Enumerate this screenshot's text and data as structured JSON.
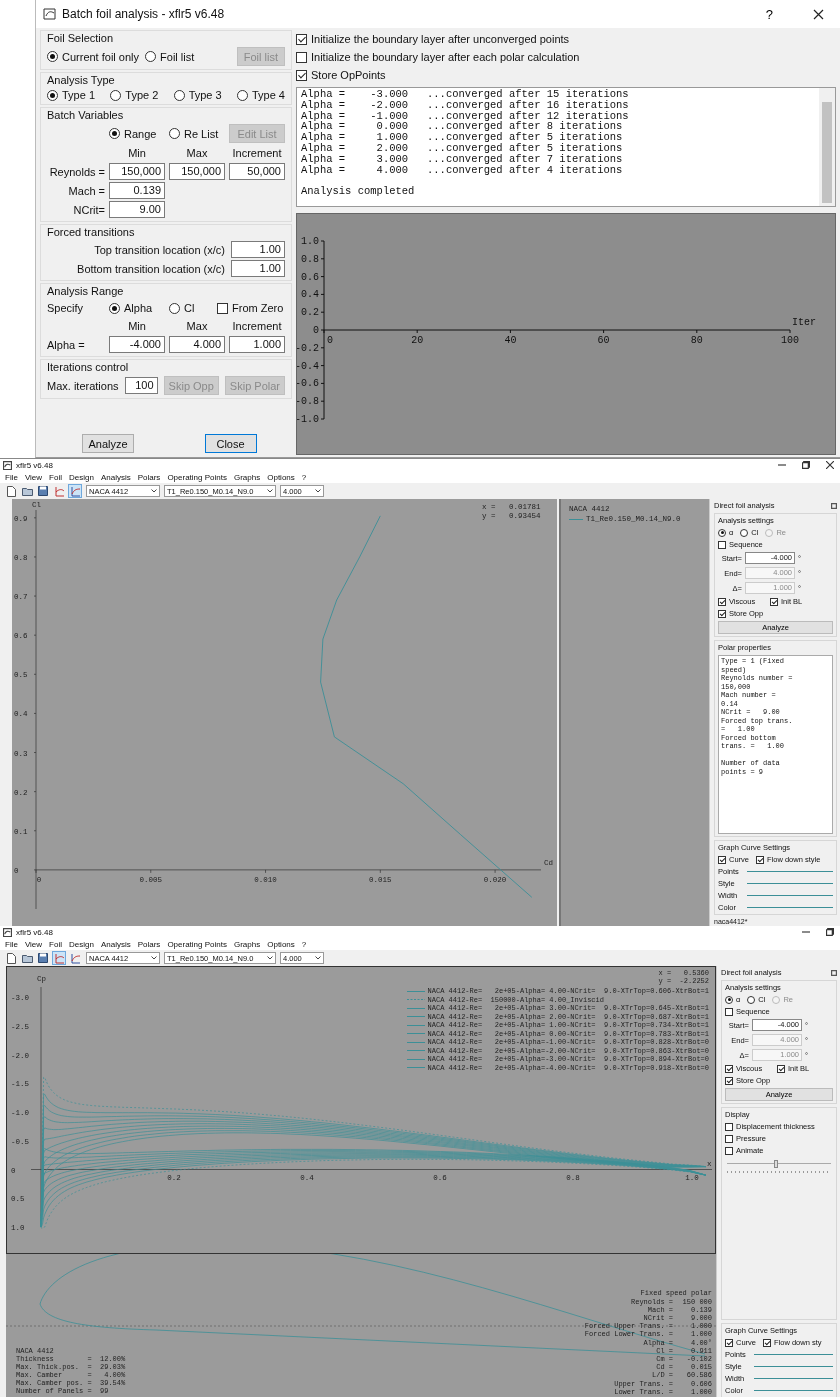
{
  "dialog": {
    "title": "Batch foil analysis - xflr5 v6.48",
    "help": "?",
    "foil_selection": {
      "title": "Foil Selection",
      "options": [
        {
          "label": "Current foil only",
          "selected": true
        },
        {
          "label": "Foil list",
          "selected": false
        }
      ],
      "button": {
        "label": "Foil list",
        "disabled": true
      }
    },
    "analysis_type": {
      "title": "Analysis Type",
      "options": [
        {
          "label": "Type 1",
          "selected": true
        },
        {
          "label": "Type 2",
          "selected": false
        },
        {
          "label": "Type 3",
          "selected": false
        },
        {
          "label": "Type 4",
          "selected": false
        }
      ]
    },
    "batch_variables": {
      "title": "Batch Variables",
      "options": [
        {
          "label": "Range",
          "selected": true
        },
        {
          "label": "Re List",
          "selected": false
        }
      ],
      "button": {
        "label": "Edit List",
        "disabled": true
      },
      "columns": [
        "Min",
        "Max",
        "Increment"
      ],
      "rows": [
        {
          "label": "Reynolds =",
          "values": [
            "150,000",
            "150,000",
            "50,000"
          ]
        },
        {
          "label": "Mach =",
          "values": [
            "0.139"
          ]
        },
        {
          "label": "NCrit=",
          "values": [
            "9.00"
          ]
        }
      ]
    },
    "forced_transitions": {
      "title": "Forced transitions",
      "rows": [
        {
          "label": "Top transition location (x/c)",
          "value": "1.00"
        },
        {
          "label": "Bottom transition location (x/c)",
          "value": "1.00"
        }
      ]
    },
    "analysis_range": {
      "title": "Analysis Range",
      "specify": "Specify",
      "options": [
        {
          "label": "Alpha",
          "selected": true
        },
        {
          "label": "Cl",
          "selected": false
        }
      ],
      "from_zero": {
        "label": "From Zero",
        "checked": false
      },
      "columns": [
        "Min",
        "Max",
        "Increment"
      ],
      "rows": [
        {
          "label": "Alpha =",
          "values": [
            "-4.000",
            "4.000",
            "1.000"
          ]
        }
      ]
    },
    "iterations": {
      "title": "Iterations control",
      "label": "Max. iterations",
      "value": "100",
      "buttons": [
        {
          "label": "Skip Opp",
          "disabled": true
        },
        {
          "label": "Skip Polar",
          "disabled": true
        }
      ]
    },
    "buttons": [
      {
        "label": "Analyze",
        "default": false
      },
      {
        "label": "Close",
        "default": true
      }
    ],
    "options": [
      {
        "label": "Initialize the boundary layer after unconverged points",
        "checked": true
      },
      {
        "label": "Initialize the boundary layer after each polar calculation",
        "checked": false
      },
      {
        "label": "Store OpPoints",
        "checked": true
      }
    ],
    "log": [
      "Alpha =    -3.000   ...converged after 15 iterations",
      "Alpha =    -2.000   ...converged after 16 iterations",
      "Alpha =    -1.000   ...converged after 12 iterations",
      "Alpha =     0.000   ...converged after 8 iterations",
      "Alpha =     1.000   ...converged after 5 iterations",
      "Alpha =     2.000   ...converged after 5 iterations",
      "Alpha =     3.000   ...converged after 7 iterations",
      "Alpha =     4.000   ...converged after 4 iterations"
    ],
    "log_summary": "Analysis completed",
    "chart_data": {
      "type": "line",
      "xlabel": "Iter",
      "xlim": [
        0,
        100
      ],
      "ylim": [
        -1,
        1
      ],
      "xticks": [
        0,
        20,
        40,
        60,
        80,
        100
      ],
      "yticks": [
        {
          "value": 1,
          "label": "1.0"
        },
        {
          "value": 0.8,
          "label": "0.8"
        },
        {
          "value": 0.6,
          "label": "0.6"
        },
        {
          "value": 0.4,
          "label": "0.4"
        },
        {
          "value": 0.2,
          "label": "0.2"
        },
        {
          "value": 0,
          "label": "0"
        },
        {
          "value": -0.2,
          "label": "-0.2"
        },
        {
          "value": -0.4,
          "label": "-0.4"
        },
        {
          "value": -0.6,
          "label": "-0.6"
        },
        {
          "value": -0.8,
          "label": "-0.8"
        },
        {
          "value": -1,
          "label": "-1.0"
        }
      ]
    }
  },
  "windows": [
    {
      "kind": "polar_view",
      "title": "xflr5 v6.48",
      "menu": [
        "File",
        "View",
        "Foil",
        "Design",
        "Analysis",
        "Polars",
        "Operating Points",
        "Graphs",
        "Options",
        "?"
      ],
      "tools": [
        {
          "selected": false
        },
        {
          "selected": false
        },
        {
          "selected": false
        },
        {
          "selected": false
        },
        {
          "selected": true
        }
      ],
      "combos": [
        "NACA 4412",
        "T1_Re0.150_M0.14_N9.0",
        "4.000"
      ],
      "readout": [
        "x =   0.01781",
        "y =   0.93454"
      ],
      "chart_data": {
        "type": "line",
        "xlabel": "Cd",
        "ylabel": "Cl",
        "xlim": [
          0,
          0.022
        ],
        "ylim": [
          -0.1,
          0.92
        ],
        "x": [
          0.0216,
          0.0185,
          0.016,
          0.013,
          0.0124,
          0.0125,
          0.0131,
          0.0141,
          0.015
        ],
        "series": [
          {
            "name": "T1_Re0.150_M0.14_N9.0",
            "color": "#3c8f97",
            "values": [
              -0.07,
              0.09,
              0.22,
              0.34,
              0.48,
              0.59,
              0.69,
              0.8,
              0.905
            ]
          }
        ],
        "xticks": [
          {
            "value": 0,
            "label": "0"
          },
          {
            "value": 0.005,
            "label": "0.005"
          },
          {
            "value": 0.01,
            "label": "0.010"
          },
          {
            "value": 0.015,
            "label": "0.015"
          },
          {
            "value": 0.02,
            "label": "0.020"
          }
        ],
        "yticks": [
          {
            "value": 0,
            "label": "0"
          },
          {
            "value": 0.1,
            "label": "0.1"
          },
          {
            "value": 0.2,
            "label": "0.2"
          },
          {
            "value": 0.3,
            "label": "0.3"
          },
          {
            "value": 0.4,
            "label": "0.4"
          },
          {
            "value": 0.5,
            "label": "0.5"
          },
          {
            "value": 0.6,
            "label": "0.6"
          },
          {
            "value": 0.7,
            "label": "0.7"
          },
          {
            "value": 0.8,
            "label": "0.8"
          },
          {
            "value": 0.9,
            "label": "0.9"
          }
        ]
      },
      "legend_title": "NACA 4412",
      "panel": {
        "title": "Direct foil analysis",
        "settings_title": "Analysis settings",
        "modes": [
          {
            "label": "α",
            "selected": true,
            "disabled": false
          },
          {
            "label": "Cl",
            "selected": false,
            "disabled": false
          },
          {
            "label": "Re",
            "selected": false,
            "disabled": true
          }
        ],
        "sequence": {
          "label": "Sequence",
          "checked": false
        },
        "fields": [
          {
            "label": "Start=",
            "value": "-4.000",
            "unit": "°",
            "disabled": false
          },
          {
            "label": "End=",
            "value": "4.000",
            "unit": "°",
            "disabled": true
          },
          {
            "label": "Δ=",
            "value": "1.000",
            "unit": "°",
            "disabled": true
          }
        ],
        "checks": [
          {
            "label": "Viscous",
            "checked": true
          },
          {
            "label": "Init BL",
            "checked": true
          },
          {
            "label": "Store Opp",
            "checked": true
          }
        ],
        "analyze": "Analyze",
        "polar_properties": {
          "title": "Polar properties",
          "text": "Type = 1 (Fixed\nspeed)\nReynolds number =\n150,000\nMach number =\n0.14\nNCrit =   9.00\nForced top trans.\n=   1.00\nForced bottom\ntrans. =   1.00\n\nNumber of data\npoints = 9"
        },
        "curve_settings": {
          "title": "Graph Curve Settings",
          "checks": [
            {
              "label": "Curve",
              "checked": true
            },
            {
              "label": "Flow down style",
              "checked": true
            }
          ],
          "rows": [
            "Points",
            "Style",
            "Width",
            "Color"
          ]
        }
      },
      "status": "naca4412*"
    },
    {
      "kind": "oppoint_view",
      "title": "xflr5 v6.48",
      "menu": [
        "File",
        "View",
        "Foil",
        "Design",
        "Analysis",
        "Polars",
        "Operating Points",
        "Graphs",
        "Options",
        "?"
      ],
      "tools": [
        {
          "selected": false
        },
        {
          "selected": false
        },
        {
          "selected": false
        },
        {
          "selected": true
        },
        {
          "selected": false
        }
      ],
      "combos": [
        "NACA 4412",
        "T1_Re0.150_M0.14_N9.0",
        "4.000"
      ],
      "readout": [
        "x =   0.5360",
        "y =  -2.2252"
      ],
      "cp_axis": {
        "ylabel": "Cp",
        "xlabel": "x",
        "yticks": [
          "-3.0",
          "-2.5",
          "-2.0",
          "-1.5",
          "-1.0",
          "-0.5",
          "0",
          "0.5",
          "1.0"
        ],
        "xticks": [
          "0.2",
          "0.4",
          "0.6",
          "0.8",
          "1.0"
        ]
      },
      "legend": [
        {
          "label": "NACA 4412-Re=   2e+05-Alpha= 4.00-NCrit=  9.0-XTrTop=0.606-XtrBot=1",
          "kind": "solid"
        },
        {
          "label": "NACA 4412-Re=  150000-Alpha= 4.00_Inviscid",
          "kind": "dashed"
        },
        {
          "label": "NACA 4412-Re=   2e+05-Alpha= 3.00-NCrit=  9.0-XTrTop=0.645-XtrBot=1",
          "kind": "solid"
        },
        {
          "label": "NACA 4412-Re=   2e+05-Alpha= 2.00-NCrit=  9.0-XTrTop=0.687-XtrBot=1",
          "kind": "solid"
        },
        {
          "label": "NACA 4412-Re=   2e+05-Alpha= 1.00-NCrit=  9.0-XTrTop=0.734-XtrBot=1",
          "kind": "solid"
        },
        {
          "label": "NACA 4412-Re=   2e+05-Alpha= 0.00-NCrit=  9.0-XTrTop=0.783-XtrBot=1",
          "kind": "solid"
        },
        {
          "label": "NACA 4412-Re=   2e+05-Alpha=-1.00-NCrit=  9.0-XTrTop=0.828-XtrBot=0",
          "kind": "solid"
        },
        {
          "label": "NACA 4412-Re=   2e+05-Alpha=-2.00-NCrit=  9.0-XTrTop=0.863-XtrBot=0",
          "kind": "solid"
        },
        {
          "label": "NACA 4412-Re=   2e+05-Alpha=-3.00-NCrit=  9.0-XTrTop=0.894-XtrBot=0",
          "kind": "solid"
        },
        {
          "label": "NACA 4412-Re=   2e+05-Alpha=-4.00-NCrit=  9.0-XTrTop=0.918-XtrBot=0",
          "kind": "solid"
        }
      ],
      "foil_properties": [
        "NACA 4412",
        "Thickness        =  12.00%",
        "Max. Thick.pos.  =  29.03%",
        "Max. Camber      =   4.00%",
        "Max. Camber pos. =  39.54%",
        "Number of Panels =  99"
      ],
      "polar_title": "Fixed speed polar",
      "results": [
        {
          "label": "Reynolds =",
          "value": "150 000"
        },
        {
          "label": "Mach =",
          "value": "0.139"
        },
        {
          "label": "NCrit =",
          "value": "9.000"
        },
        {
          "label": "Forced Upper Trans. =",
          "value": "1.000"
        },
        {
          "label": "Forced Lower Trans. =",
          "value": "1.000"
        },
        {
          "label": "Alpha =",
          "value": "4.00°"
        },
        {
          "label": "Cl =",
          "value": "0.911"
        },
        {
          "label": "Cm =",
          "value": "-0.102"
        },
        {
          "label": "Cd =",
          "value": "0.015"
        },
        {
          "label": "L/D =",
          "value": "60.586"
        },
        {
          "label": "Upper Trans. =",
          "value": "0.606"
        },
        {
          "label": "Lower Trans. =",
          "value": "1.000"
        }
      ],
      "panel": {
        "title": "Direct foil analysis",
        "settings_title": "Analysis settings",
        "modes": [
          {
            "label": "α",
            "selected": true,
            "disabled": false
          },
          {
            "label": "Cl",
            "selected": false,
            "disabled": false
          },
          {
            "label": "Re",
            "selected": false,
            "disabled": true
          }
        ],
        "sequence": {
          "label": "Sequence",
          "checked": false
        },
        "fields": [
          {
            "label": "Start=",
            "value": "-4.000",
            "unit": "°",
            "disabled": false
          },
          {
            "label": "End=",
            "value": "4.000",
            "unit": "°",
            "disabled": true
          },
          {
            "label": "Δ=",
            "value": "1.000",
            "unit": "°",
            "disabled": true
          }
        ],
        "checks": [
          {
            "label": "Viscous",
            "checked": true
          },
          {
            "label": "Init BL",
            "checked": true
          },
          {
            "label": "Store Opp",
            "checked": true
          }
        ],
        "analyze": "Analyze",
        "display": {
          "title": "Display",
          "checks": [
            {
              "label": "Displacement thickness",
              "checked": false
            },
            {
              "label": "Pressure",
              "checked": false
            },
            {
              "label": "Animate",
              "checked": false
            }
          ],
          "slider": {
            "level": 0.45
          }
        },
        "curve_settings": {
          "title": "Graph Curve Settings",
          "checks": [
            {
              "label": "Curve",
              "checked": true
            },
            {
              "label": "Flow down sty",
              "checked": true
            }
          ],
          "rows": [
            "Points",
            "Style",
            "Width",
            "Color"
          ]
        }
      }
    }
  ]
}
